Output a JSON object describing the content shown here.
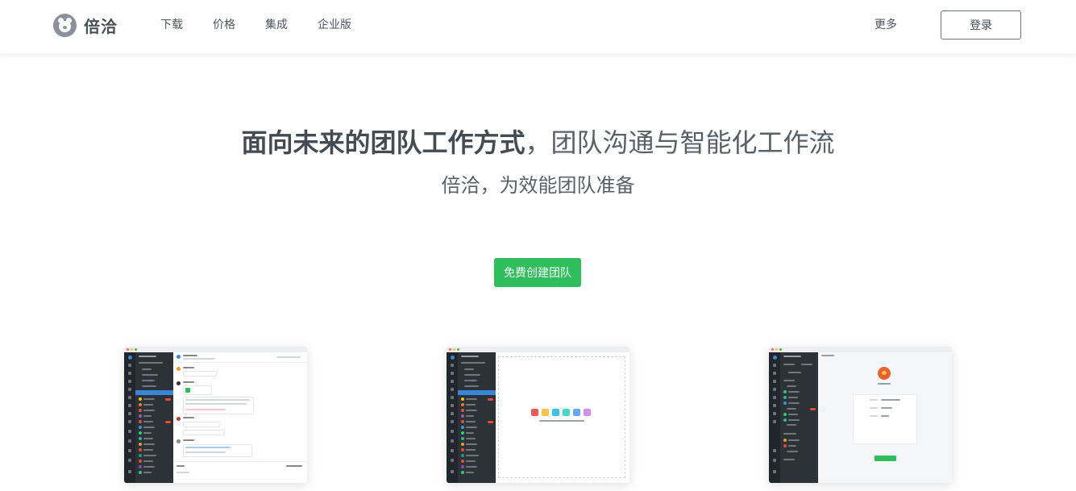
{
  "brand": {
    "name": "倍洽"
  },
  "nav": {
    "items": [
      {
        "label": "下载"
      },
      {
        "label": "价格"
      },
      {
        "label": "集成"
      },
      {
        "label": "企业版"
      }
    ],
    "more_label": "更多",
    "login_label": "登录"
  },
  "hero": {
    "title_bold": "面向未来的团队工作方式",
    "title_rest": "，团队沟通与智能化工作流",
    "subtitle": "倍洽，为效能团队准备",
    "cta_label": "免费创建团队"
  },
  "colors": {
    "accent_green": "#2ebf5c",
    "text_dark": "#454b53",
    "sidebar_dark": "#2d3138",
    "selection_blue": "#3a86d8"
  },
  "screenshots": [
    {
      "name": "chat-preview"
    },
    {
      "name": "files-preview"
    },
    {
      "name": "settings-preview"
    }
  ]
}
